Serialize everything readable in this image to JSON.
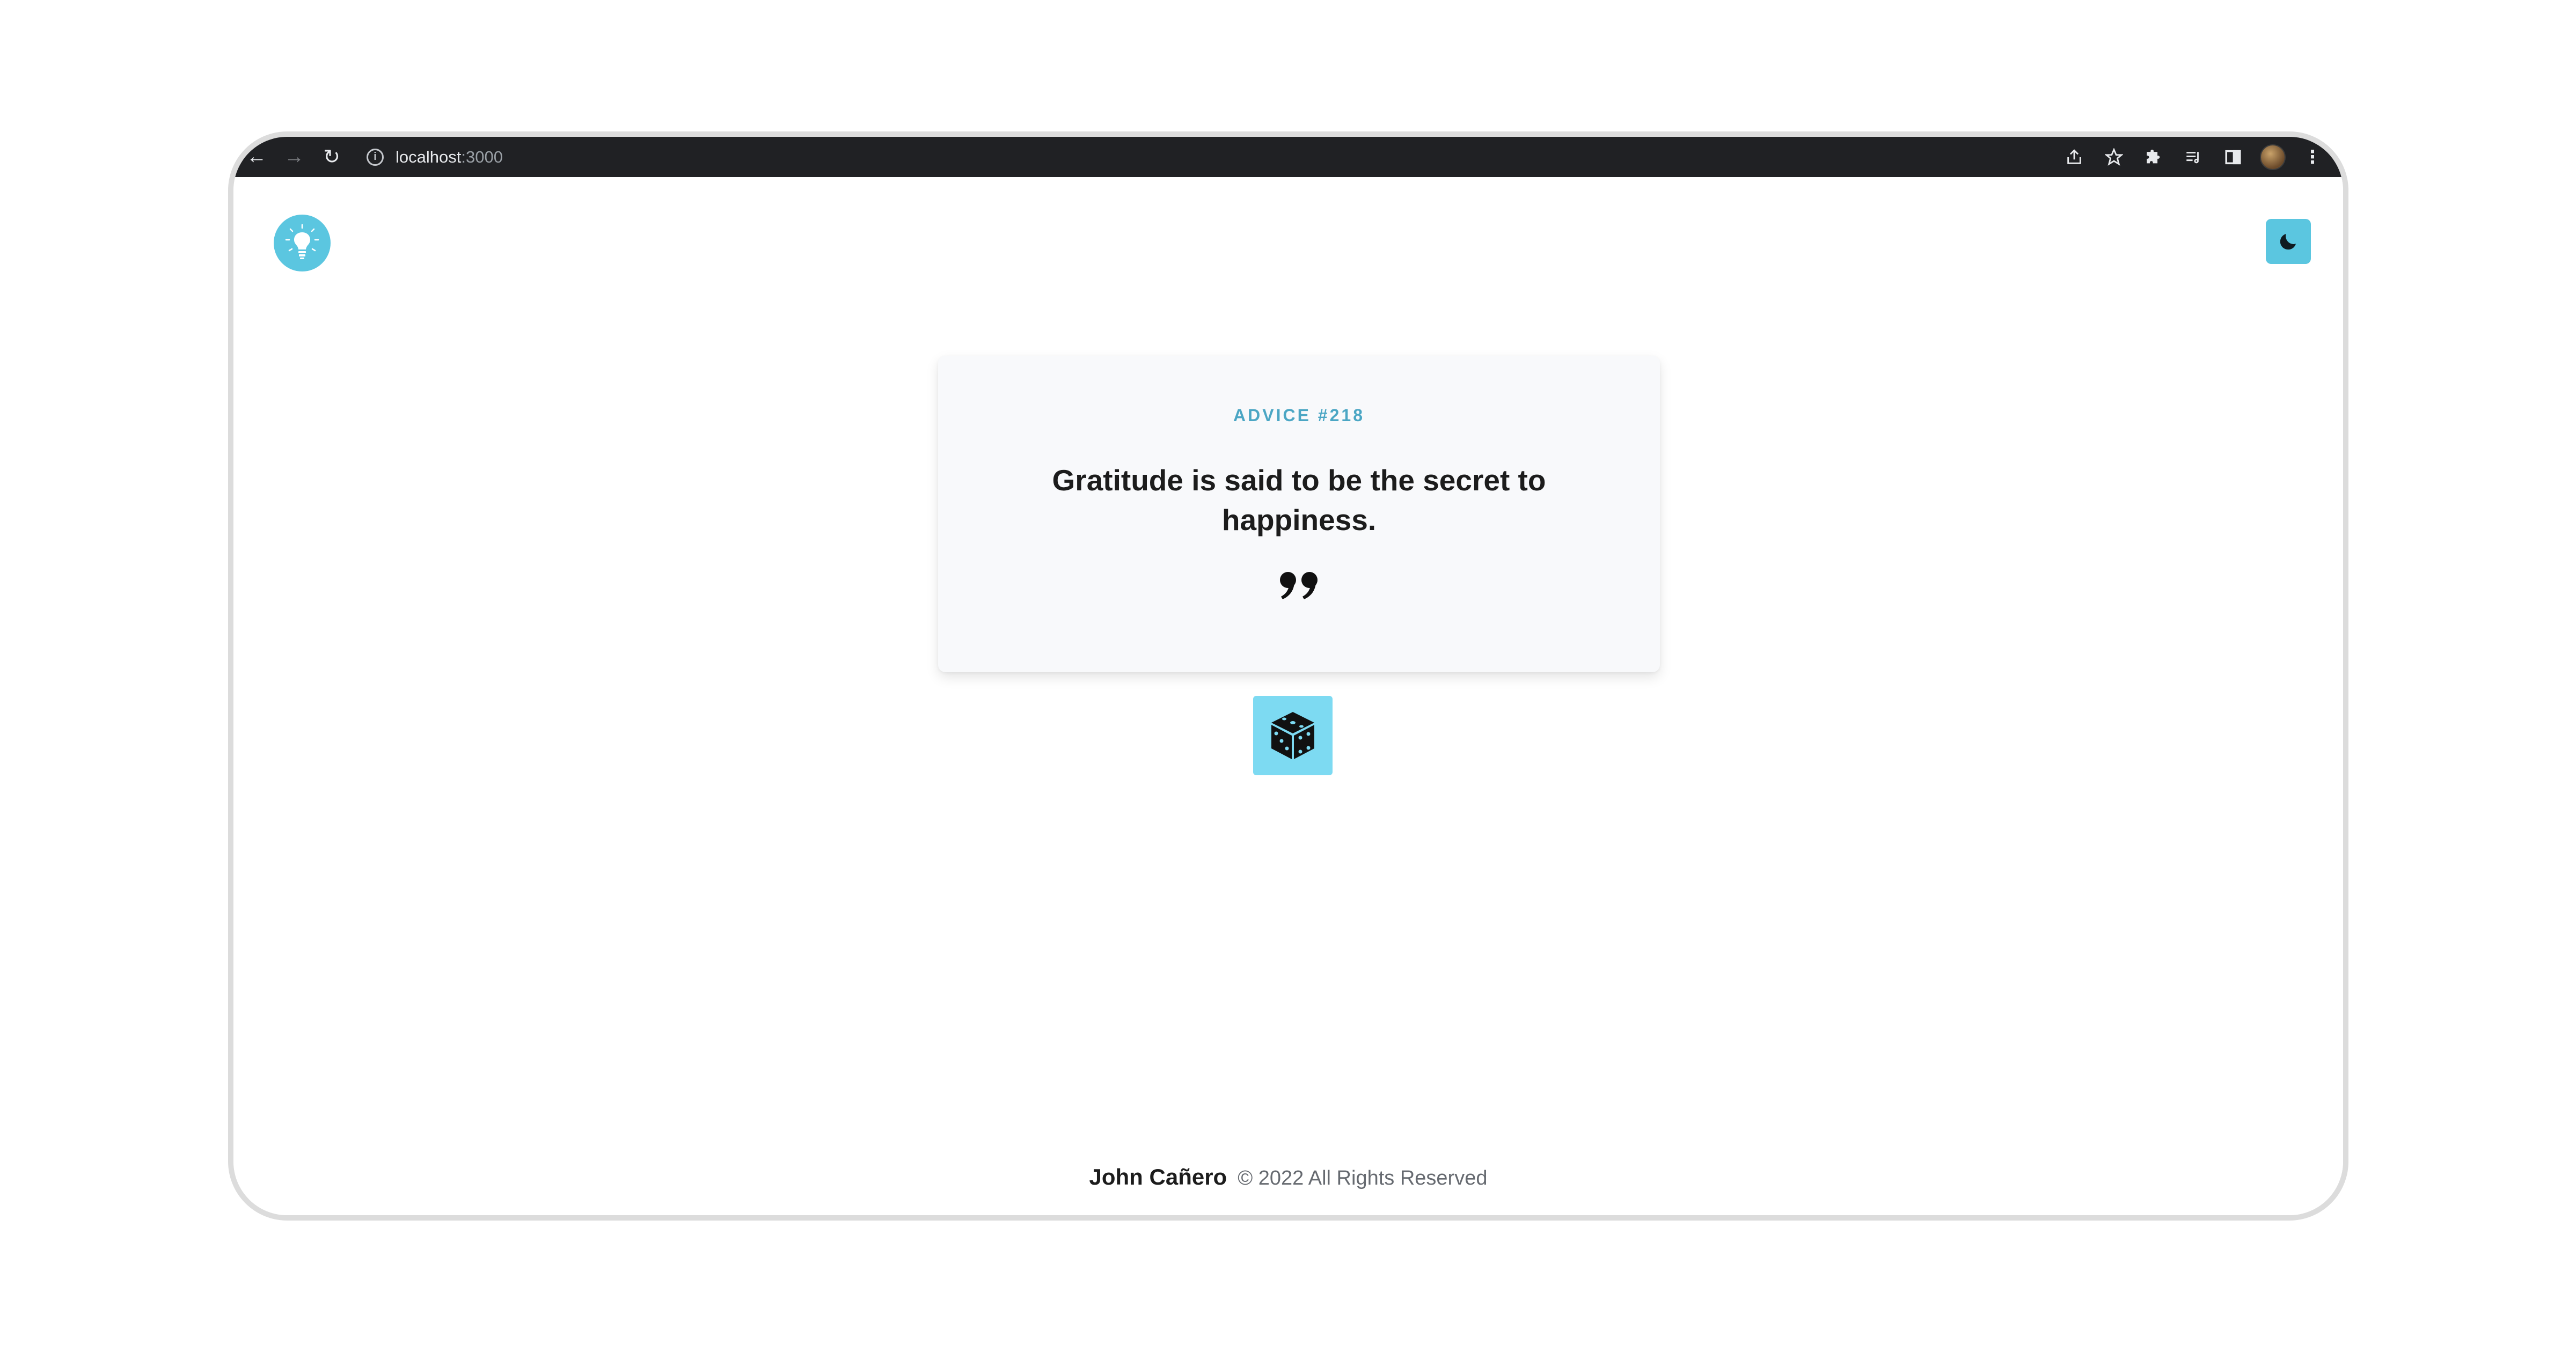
{
  "browser": {
    "url_host": "localhost",
    "url_port": ":3000",
    "back_icon": "arrow-left-icon",
    "forward_icon": "arrow-right-icon",
    "reload_icon": "reload-icon"
  },
  "header": {
    "logo_icon": "lightbulb-icon",
    "theme_toggle_icon": "moon-icon"
  },
  "card": {
    "advice_id": "ADVICE #218",
    "advice_text": "Gratitude is said to be the secret to happiness.",
    "quote_icon": "quote-icon"
  },
  "dice_button": {
    "icon": "dice-icon"
  },
  "footer": {
    "author": "John Cañero",
    "rights": "© 2022 All Rights Reserved"
  },
  "colors": {
    "accent": "#5bc6e0",
    "dice_bg": "#7ddaf2",
    "advice_id": "#4ba6c4",
    "card_bg": "#f8f9fb",
    "browser_bar": "#202124"
  }
}
